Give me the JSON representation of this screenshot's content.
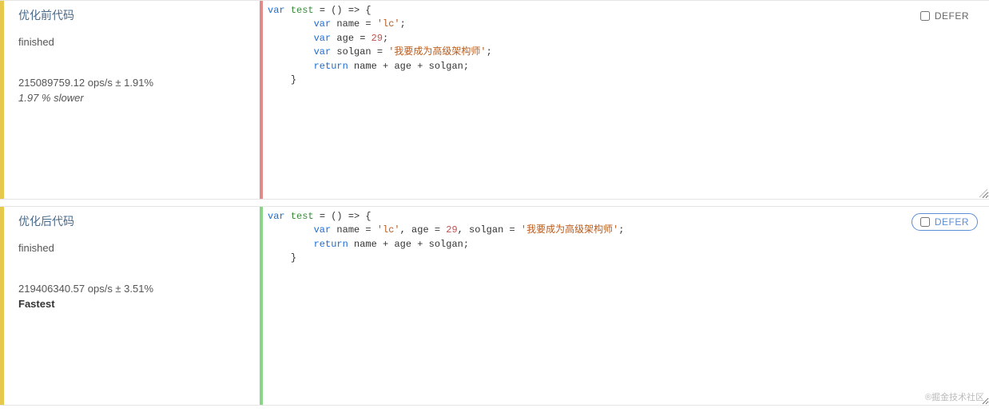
{
  "cases": [
    {
      "title": "优化前代码",
      "status": "finished",
      "ops": "215089759.12 ops/s ± 1.91%",
      "note": "1.97 % slower",
      "fastest": false,
      "bar_color": "red",
      "defer_label": "DEFER",
      "defer_active": false,
      "code": {
        "line1_kw": "var",
        "line1_fn": "test",
        "line1_rest": " = () => {",
        "line2_kw": "var",
        "line2_name": " name = ",
        "line2_str": "'lc'",
        "line2_end": ";",
        "line3_kw": "var",
        "line3_name": " age = ",
        "line3_num": "29",
        "line3_end": ";",
        "line4_kw": "var",
        "line4_name": " solgan = ",
        "line4_str": "'我要成为高级架构师'",
        "line4_end": ";",
        "line5_kw": "return",
        "line5_rest": " name + age + solgan;",
        "line6": "}"
      }
    },
    {
      "title": "优化后代码",
      "status": "finished",
      "ops": "219406340.57 ops/s ± 3.51%",
      "note": "Fastest",
      "fastest": true,
      "bar_color": "green",
      "defer_label": "DEFER",
      "defer_active": true,
      "code": {
        "line1_kw": "var",
        "line1_fn": "test",
        "line1_rest": " = () => {",
        "line2_kw": "var",
        "line2_a": " name = ",
        "line2_str1": "'lc'",
        "line2_b": ", age = ",
        "line2_num": "29",
        "line2_c": ", solgan = ",
        "line2_str2": "'我要成为高级架构师'",
        "line2_end": ";",
        "line3_kw": "return",
        "line3_rest": " name + age + solgan;",
        "line4": "}"
      }
    }
  ],
  "watermark": "®掘金技术社区"
}
